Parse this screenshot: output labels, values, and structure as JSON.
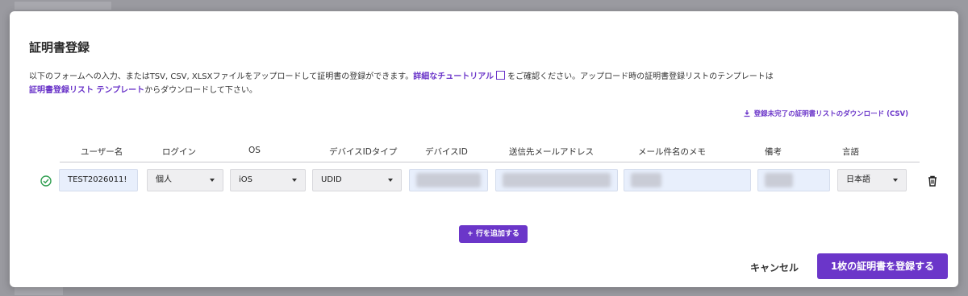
{
  "modal": {
    "title": "証明書登録",
    "desc_part1": "以下のフォームへの入力、またはTSV, CSV, XLSXファイルをアップロードして証明書の登録ができます。",
    "tutorial_link": "詳細なチュートリアル",
    "desc_part2": "をご確認ください。アップロード時の証明書登録リストのテンプレートは",
    "template_link": "証明書登録リスト テンプレート",
    "desc_part3": "からダウンロードして下さい。",
    "download_link": "登録未完了の証明書リストのダウンロード (CSV)"
  },
  "table": {
    "headers": [
      "ユーザー名",
      "ログイン",
      "OS",
      "デバイスIDタイプ",
      "デバイスID",
      "送信先メールアドレス",
      "メール件名のメモ",
      "備考",
      "言語"
    ],
    "row": {
      "username": "TEST2026011!",
      "login": "個人",
      "os": "iOS",
      "device_id_type": "UDID",
      "language": "日本語"
    }
  },
  "buttons": {
    "add_row": "+ 行を追加する",
    "cancel": "キャンセル",
    "submit": "1枚の証明書を登録する"
  },
  "colors": {
    "accent": "#6b36c9",
    "success": "#2e9e4f"
  },
  "icons": {
    "status": "check-circle-icon",
    "delete": "trash-icon",
    "external": "external-link-icon",
    "download": "download-icon"
  }
}
